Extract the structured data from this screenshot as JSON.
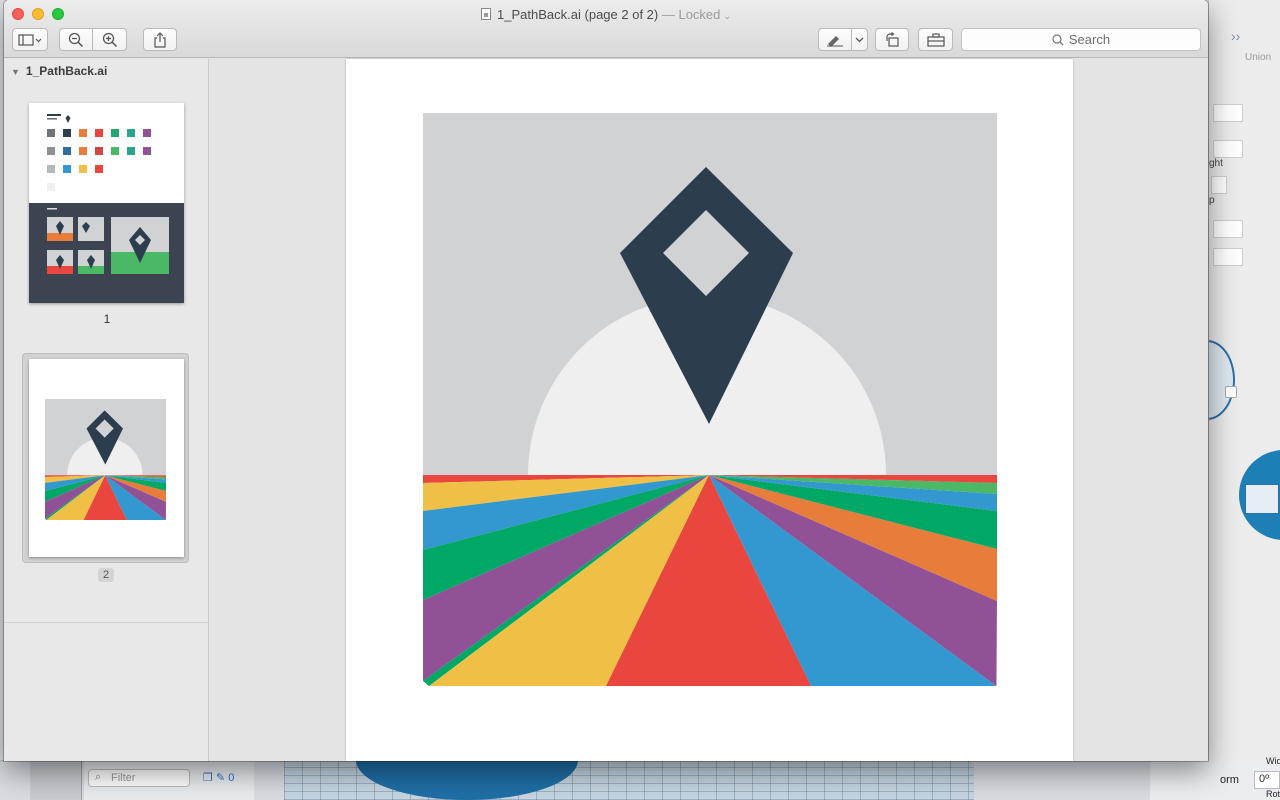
{
  "window": {
    "doc_name": "1_PathBack.ai",
    "page_info": "(page 2 of 2)",
    "locked": "— Locked"
  },
  "toolbar": {
    "sidebar_icon": "sidebar-icon",
    "zoom_out_icon": "zoom-out-icon",
    "zoom_in_icon": "zoom-in-icon",
    "share_icon": "share-icon",
    "markup_icon": "markup-pen-icon",
    "rotate_icon": "rotate-left-icon",
    "toolbox_icon": "toolbox-icon",
    "search_placeholder": "Search"
  },
  "sidebar": {
    "header": "1_PathBack.ai",
    "pages": [
      {
        "number": "1"
      },
      {
        "number": "2",
        "selected": true
      }
    ]
  },
  "artwork": {
    "sky_color": "#d1d2d4",
    "sun_color": "#efeff0",
    "pin_color": "#2c3d4e",
    "ray_colors": [
      "#e8463f",
      "#f0bf45",
      "#00a866",
      "#915196",
      "#3498d0",
      "#e87c3b",
      "#4bb866"
    ]
  },
  "background_app": {
    "union_label": "Union",
    "height_label": "ght",
    "p_label": "p",
    "filter_placeholder": "Filter",
    "filter_count": "0",
    "form_label": "orm",
    "rotation_value": "0º",
    "width_label": "Wid",
    "rot_label": "Rot"
  }
}
